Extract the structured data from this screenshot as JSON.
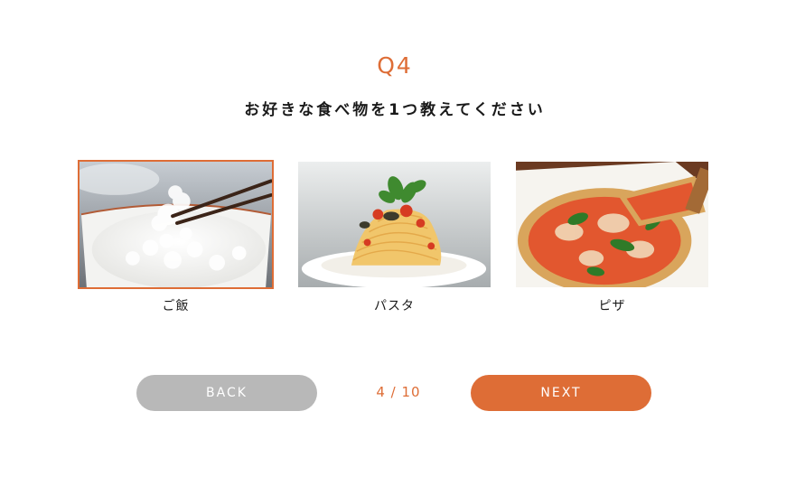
{
  "question": {
    "number": "Q4",
    "text": "お好きな食べ物を1つ教えてください"
  },
  "options": [
    {
      "label": "ご飯",
      "selected": true,
      "image": "rice-bowl-photo"
    },
    {
      "label": "パスタ",
      "selected": false,
      "image": "pasta-photo"
    },
    {
      "label": "ピザ",
      "selected": false,
      "image": "pizza-photo"
    }
  ],
  "navigation": {
    "back_label": "BACK",
    "next_label": "NEXT",
    "progress": "4 / 10",
    "current": 4,
    "total": 10
  },
  "colors": {
    "accent": "#de6d36",
    "back_button": "#b8b8b8"
  }
}
